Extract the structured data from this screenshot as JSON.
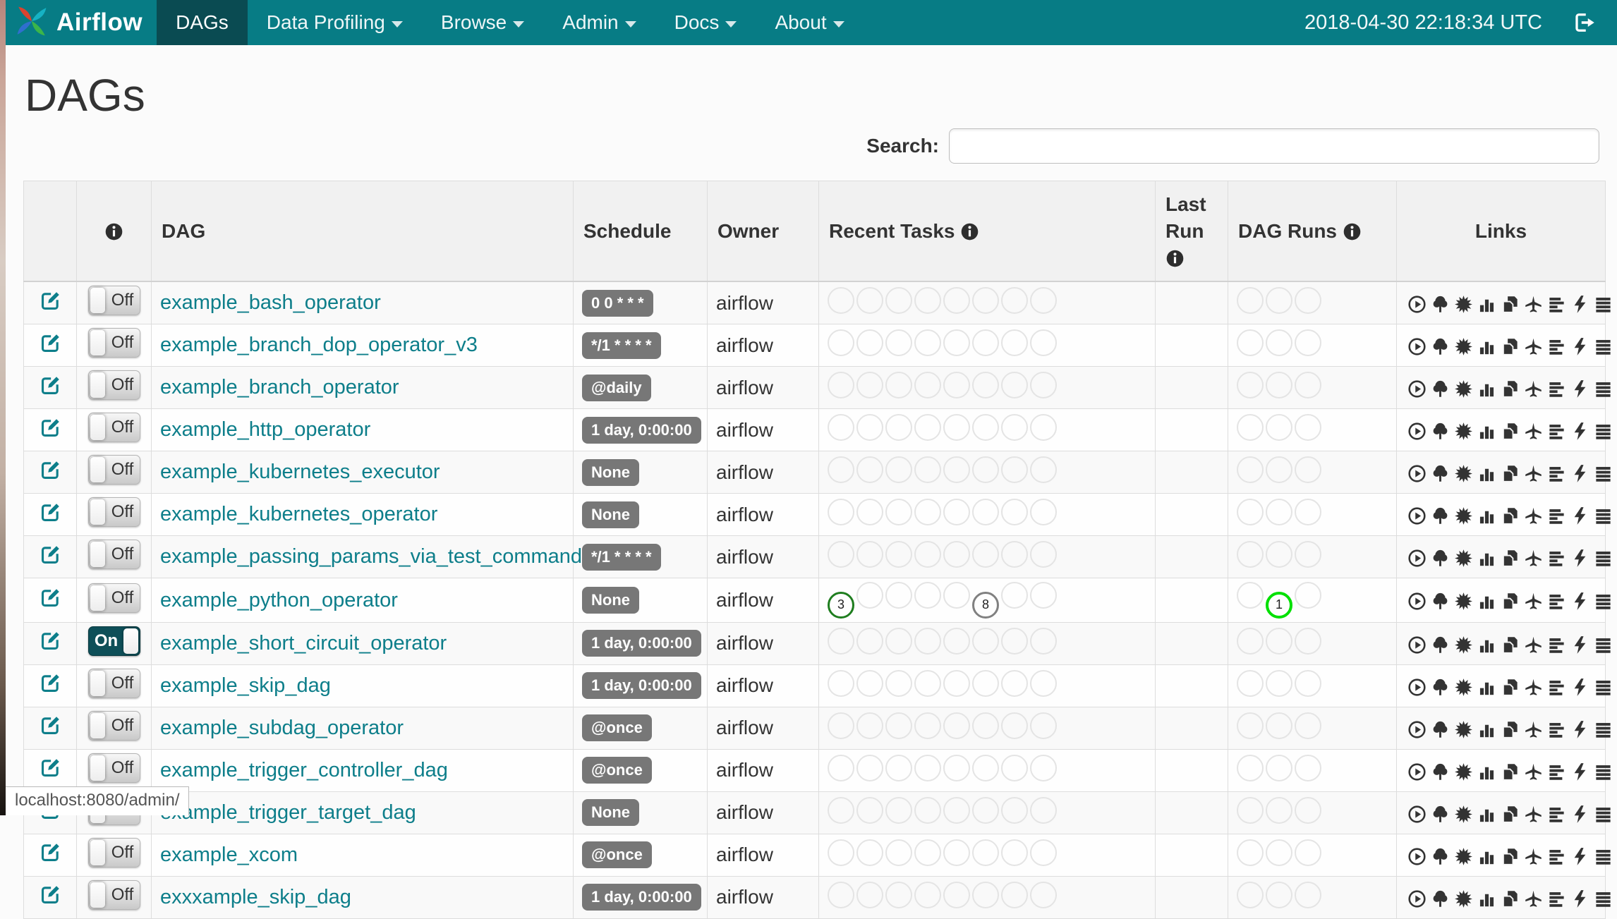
{
  "navbar": {
    "brand": "Airflow",
    "items": [
      {
        "label": "DAGs",
        "active": true,
        "caret": false
      },
      {
        "label": "Data Profiling",
        "active": false,
        "caret": true
      },
      {
        "label": "Browse",
        "active": false,
        "caret": true
      },
      {
        "label": "Admin",
        "active": false,
        "caret": true
      },
      {
        "label": "Docs",
        "active": false,
        "caret": true
      },
      {
        "label": "About",
        "active": false,
        "caret": true
      }
    ],
    "clock": "2018-04-30 22:18:34 UTC"
  },
  "page": {
    "title": "DAGs",
    "search_label": "Search:",
    "search_value": "",
    "status_bar": "localhost:8080/admin/"
  },
  "toggle_labels": {
    "on": "On",
    "off": "Off"
  },
  "table": {
    "headers": {
      "dag": "DAG",
      "schedule": "Schedule",
      "owner": "Owner",
      "recent_tasks": "Recent Tasks",
      "last_run": "Last Run",
      "dag_runs": "DAG Runs",
      "links": "Links"
    },
    "recent_task_slots": 8,
    "dag_run_slots": 3,
    "link_icons": [
      "trigger-dag-icon",
      "tree-view-icon",
      "graph-view-icon",
      "task-duration-icon",
      "task-tries-icon",
      "landing-times-icon",
      "gantt-view-icon",
      "code-view-icon",
      "logs-icon",
      "refresh-icon"
    ],
    "rows": [
      {
        "dag": "example_bash_operator",
        "schedule": "0 0 * * *",
        "owner": "airflow",
        "paused": true,
        "last_run": "",
        "recent_tasks": [],
        "dag_runs": []
      },
      {
        "dag": "example_branch_dop_operator_v3",
        "schedule": "*/1 * * * *",
        "owner": "airflow",
        "paused": true,
        "last_run": "",
        "recent_tasks": [],
        "dag_runs": []
      },
      {
        "dag": "example_branch_operator",
        "schedule": "@daily",
        "owner": "airflow",
        "paused": true,
        "last_run": "",
        "recent_tasks": [],
        "dag_runs": []
      },
      {
        "dag": "example_http_operator",
        "schedule": "1 day, 0:00:00",
        "owner": "airflow",
        "paused": true,
        "last_run": "",
        "recent_tasks": [],
        "dag_runs": []
      },
      {
        "dag": "example_kubernetes_executor",
        "schedule": "None",
        "owner": "airflow",
        "paused": true,
        "last_run": "",
        "recent_tasks": [],
        "dag_runs": []
      },
      {
        "dag": "example_kubernetes_operator",
        "schedule": "None",
        "owner": "airflow",
        "paused": true,
        "last_run": "",
        "recent_tasks": [],
        "dag_runs": []
      },
      {
        "dag": "example_passing_params_via_test_command",
        "schedule": "*/1 * * * *",
        "owner": "airflow",
        "paused": true,
        "last_run": "",
        "recent_tasks": [],
        "dag_runs": []
      },
      {
        "dag": "example_python_operator",
        "schedule": "None",
        "owner": "airflow",
        "paused": true,
        "last_run": "",
        "recent_tasks": [
          {
            "slot": 0,
            "count": 3,
            "state": "success"
          },
          {
            "slot": 5,
            "count": 8,
            "state": "queued"
          }
        ],
        "dag_runs": [
          {
            "slot": 1,
            "count": 1,
            "state": "running"
          }
        ]
      },
      {
        "dag": "example_short_circuit_operator",
        "schedule": "1 day, 0:00:00",
        "owner": "airflow",
        "paused": false,
        "last_run": "",
        "recent_tasks": [],
        "dag_runs": []
      },
      {
        "dag": "example_skip_dag",
        "schedule": "1 day, 0:00:00",
        "owner": "airflow",
        "paused": true,
        "last_run": "",
        "recent_tasks": [],
        "dag_runs": []
      },
      {
        "dag": "example_subdag_operator",
        "schedule": "@once",
        "owner": "airflow",
        "paused": true,
        "last_run": "",
        "recent_tasks": [],
        "dag_runs": []
      },
      {
        "dag": "example_trigger_controller_dag",
        "schedule": "@once",
        "owner": "airflow",
        "paused": true,
        "last_run": "",
        "recent_tasks": [],
        "dag_runs": []
      },
      {
        "dag": "example_trigger_target_dag",
        "schedule": "None",
        "owner": "airflow",
        "paused": true,
        "last_run": "",
        "recent_tasks": [],
        "dag_runs": []
      },
      {
        "dag": "example_xcom",
        "schedule": "@once",
        "owner": "airflow",
        "paused": true,
        "last_run": "",
        "recent_tasks": [],
        "dag_runs": []
      },
      {
        "dag": "exxxample_skip_dag",
        "schedule": "1 day, 0:00:00",
        "owner": "airflow",
        "paused": true,
        "last_run": "",
        "recent_tasks": [],
        "dag_runs": []
      }
    ]
  },
  "colors": {
    "navbar": "#077c85",
    "navbar_active": "#0a4b52",
    "link": "#0d7e8a",
    "badge": "#777777",
    "task_success": "#1e7d1e",
    "task_queued": "#808080",
    "run_running": "#00e000",
    "toggle_on": "#0e4f58"
  }
}
